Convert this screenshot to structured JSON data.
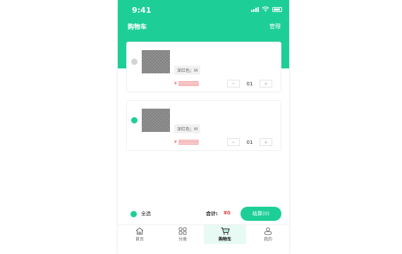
{
  "status_bar": {
    "time": "9:41"
  },
  "header": {
    "title": "购物车",
    "manage_label": "管理"
  },
  "cart_items": [
    {
      "selected": false,
      "spec": "深红色；M",
      "price_symbol": "¥",
      "quantity": "01",
      "minus": "−",
      "plus": "+"
    },
    {
      "selected": true,
      "spec": "深红色；M",
      "price_symbol": "¥",
      "quantity": "01",
      "minus": "−",
      "plus": "+"
    }
  ],
  "footer": {
    "select_all_label": "全选",
    "total_label": "合计:",
    "total_value": "¥0",
    "checkout_label": "结算(0)"
  },
  "tabbar": [
    {
      "label": "首页",
      "icon": "home-icon"
    },
    {
      "label": "分类",
      "icon": "category-icon"
    },
    {
      "label": "购物车",
      "icon": "cart-icon",
      "active": true
    },
    {
      "label": "我的",
      "icon": "profile-icon"
    }
  ],
  "colors": {
    "accent": "#1dcf96",
    "price": "#e64545"
  }
}
